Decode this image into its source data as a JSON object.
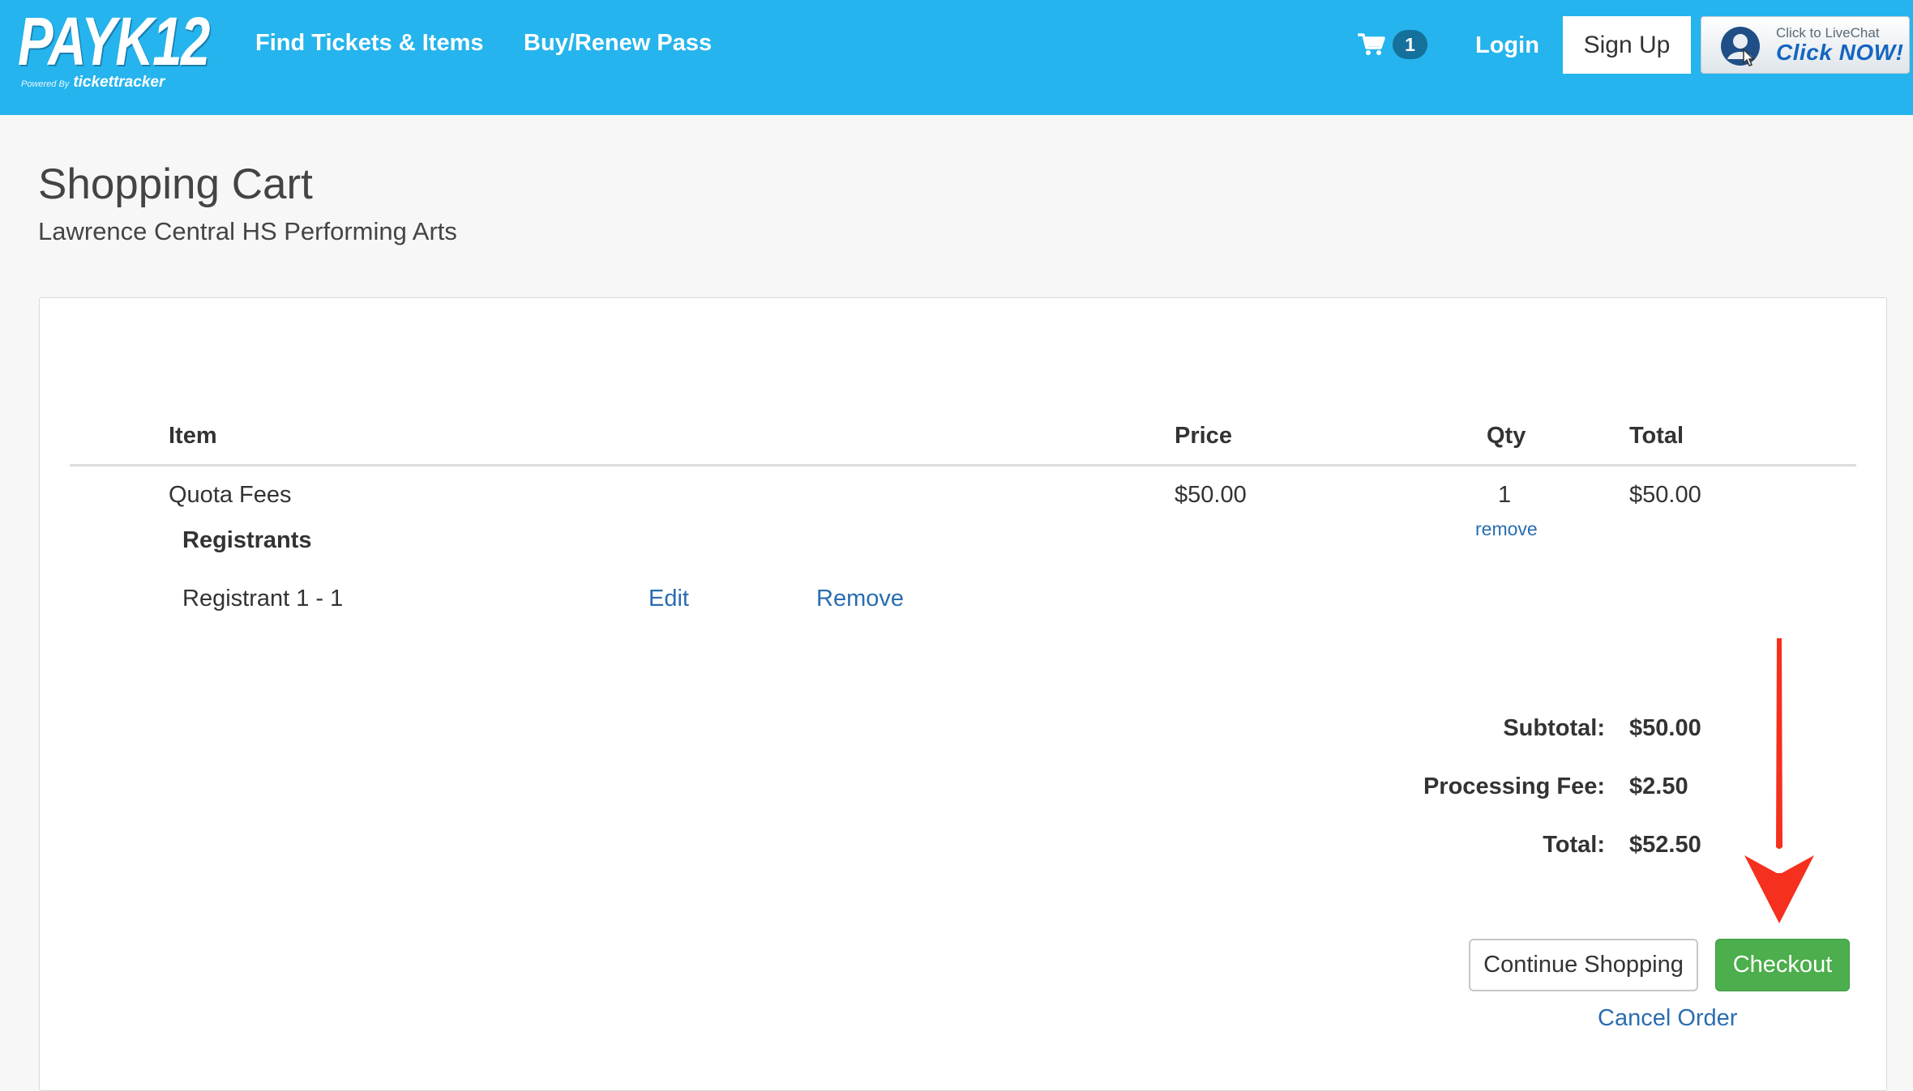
{
  "nav": {
    "logo_text": "PAYK12",
    "logo_powered_by": "Powered By",
    "logo_brand": "tickettracker",
    "links": [
      "Find Tickets & Items",
      "Buy/Renew Pass"
    ],
    "cart_count": "1",
    "login_label": "Login",
    "signup_label": "Sign Up",
    "livechat_small": "Click to LiveChat",
    "livechat_big": "Click NOW!",
    "color": "#25b4ed"
  },
  "page": {
    "title": "Shopping Cart",
    "organization": "Lawrence Central HS Performing Arts"
  },
  "cart": {
    "columns": {
      "item": "Item",
      "price": "Price",
      "qty": "Qty",
      "total": "Total"
    },
    "row": {
      "item": "Quota Fees",
      "price": "$50.00",
      "qty": "1",
      "total": "$50.00",
      "remove_label": "remove",
      "registrants_heading": "Registrants",
      "registrant": {
        "name": "Registrant 1 - 1",
        "edit_label": "Edit",
        "remove_label": "Remove"
      }
    },
    "summary": {
      "subtotal_label": "Subtotal:",
      "subtotal": "$50.00",
      "fee_label": "Processing Fee:",
      "fee": "$2.50",
      "total_label": "Total:",
      "total": "$52.50"
    },
    "buttons": {
      "continue": "Continue Shopping",
      "checkout": "Checkout",
      "cancel": "Cancel Order"
    },
    "checkout_color": "#4cae4c",
    "arrow_color": "#f5301e"
  }
}
